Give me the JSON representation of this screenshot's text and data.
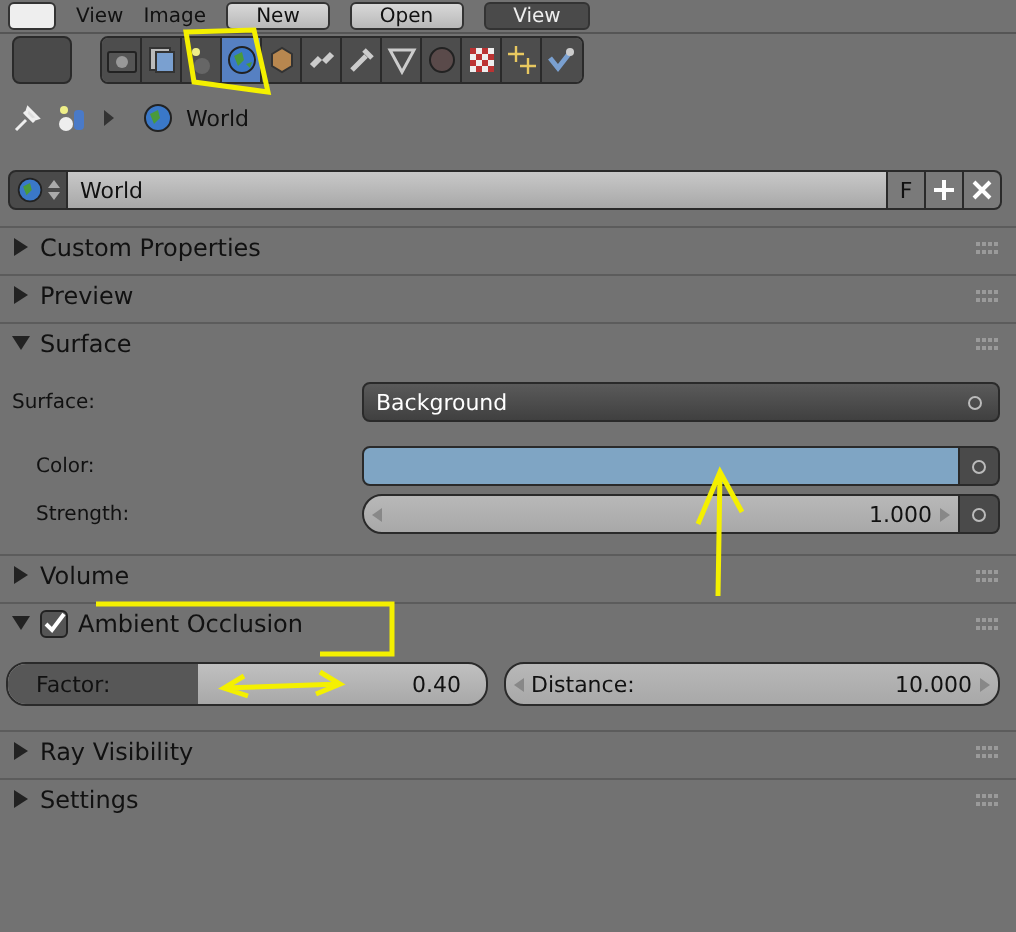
{
  "header": [
    {
      "kind": "menu",
      "label": "View"
    },
    {
      "kind": "menu",
      "label": "Image"
    },
    {
      "kind": "button",
      "label": "New"
    },
    {
      "kind": "button",
      "label": "Open"
    },
    {
      "kind": "dropdown",
      "label": "View"
    }
  ],
  "tabs": [
    {
      "kind": "render",
      "selected": false
    },
    {
      "kind": "layers",
      "selected": false
    },
    {
      "kind": "scene",
      "selected": false
    },
    {
      "kind": "world",
      "selected": true
    },
    {
      "kind": "object",
      "selected": false
    },
    {
      "kind": "constraints",
      "selected": false
    },
    {
      "kind": "modifiers",
      "selected": false
    },
    {
      "kind": "data",
      "selected": false
    },
    {
      "kind": "material",
      "selected": false
    },
    {
      "kind": "texture",
      "selected": false
    },
    {
      "kind": "particles",
      "selected": false
    },
    {
      "kind": "physics",
      "selected": false
    }
  ],
  "breadcrumb": "World",
  "datablock": {
    "name": "World",
    "fake_user": "F"
  },
  "panels": [
    {
      "title": "Custom Properties",
      "expanded": false
    },
    {
      "title": "Preview",
      "expanded": false
    },
    {
      "title": "Surface",
      "expanded": true,
      "rows": [
        {
          "kind": "dropdown",
          "label": "Surface:",
          "value": "Background"
        },
        {
          "kind": "color",
          "label": "Color:",
          "color": "#7fa5c4"
        },
        {
          "kind": "number",
          "label": "Strength:",
          "value": "1.000"
        }
      ]
    },
    {
      "title": "Volume",
      "expanded": false
    },
    {
      "title": "Ambient Occlusion",
      "expanded": true,
      "checked": true,
      "fields": [
        {
          "kind": "slider",
          "label": "Factor:",
          "value": "0.40",
          "level": 0.4
        },
        {
          "kind": "number",
          "label": "Distance:",
          "value": "10.000"
        }
      ]
    },
    {
      "title": "Ray Visibility",
      "expanded": false
    },
    {
      "title": "Settings",
      "expanded": false
    }
  ]
}
